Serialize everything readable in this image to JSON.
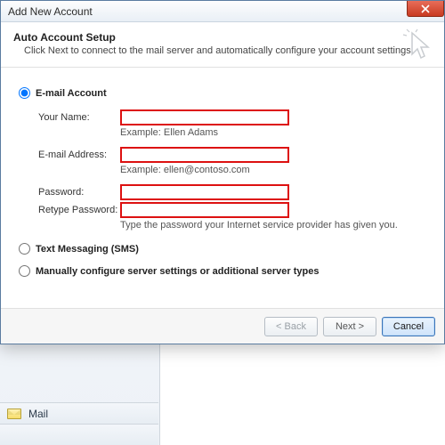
{
  "window": {
    "title": "Add New Account"
  },
  "header": {
    "title": "Auto Account Setup",
    "subtitle": "Click Next to connect to the mail server and automatically configure your account settings."
  },
  "options": {
    "email": "E-mail Account",
    "sms": "Text Messaging (SMS)",
    "manual": "Manually configure server settings or additional server types"
  },
  "fields": {
    "name_label": "Your Name:",
    "name_hint": "Example: Ellen Adams",
    "email_label": "E-mail Address:",
    "email_hint": "Example: ellen@contoso.com",
    "password_label": "Password:",
    "retype_label": "Retype Password:",
    "password_hint": "Type the password your Internet service provider has given you."
  },
  "buttons": {
    "back": "< Back",
    "next": "Next >",
    "cancel": "Cancel"
  },
  "nav": {
    "mail": "Mail"
  }
}
